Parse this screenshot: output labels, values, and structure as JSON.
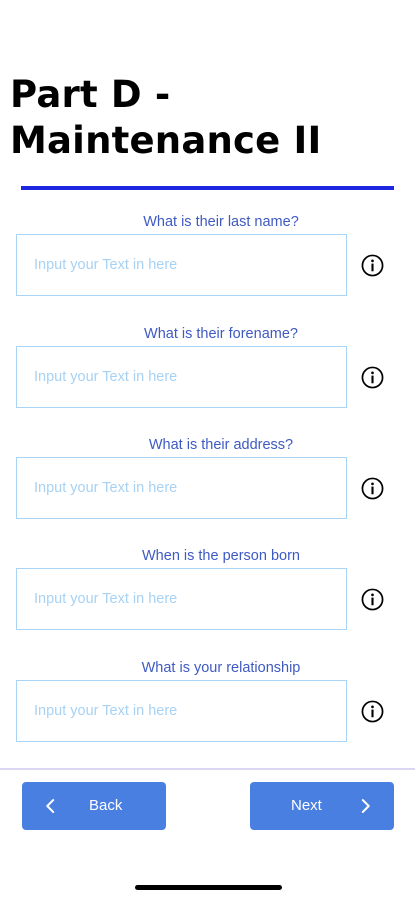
{
  "header": {
    "title": "Part D - Maintenance II"
  },
  "colors": {
    "accent": "#1d27e0",
    "label": "#3f5ac2",
    "input_border": "#a9d4f5",
    "placeholder": "#a7d2f4",
    "button": "#4a7fe2"
  },
  "form": {
    "fields": [
      {
        "label": "What is their last name?",
        "value": "",
        "placeholder": "Input your Text in here",
        "icon": "info-icon"
      },
      {
        "label": "What is their forename?",
        "value": "",
        "placeholder": "Input your Text in here",
        "icon": "info-icon"
      },
      {
        "label": "What is their address?",
        "value": "",
        "placeholder": "Input your Text in here",
        "icon": "info-icon"
      },
      {
        "label": "When is the person born",
        "value": "",
        "placeholder": "Input your Text in here",
        "icon": "info-icon"
      },
      {
        "label": "What is your relationship",
        "value": "",
        "placeholder": "Input your Text in here",
        "icon": "info-icon"
      }
    ]
  },
  "footer": {
    "back_label": "Back",
    "back_icon": "chevron-left-icon",
    "next_label": "Next",
    "next_icon": "chevron-right-icon"
  }
}
